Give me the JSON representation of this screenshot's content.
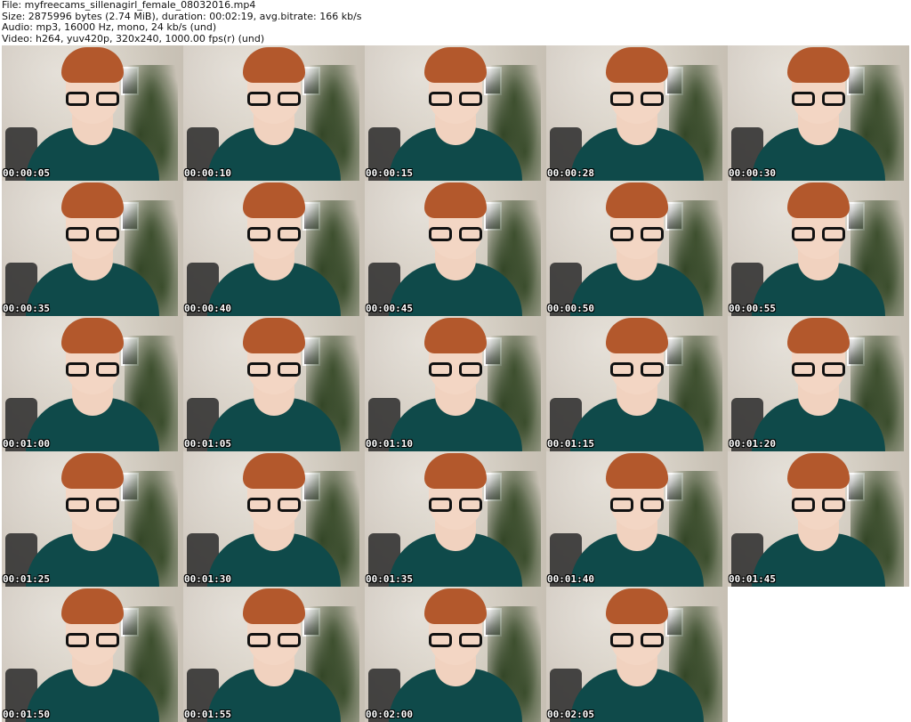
{
  "header": {
    "file": "File: myfreecams_sillenagirl_female_08032016.mp4",
    "size": "Size: 2875996 bytes (2.74 MiB), duration: 00:02:19, avg.bitrate: 166 kb/s",
    "audio": "Audio: mp3, 16000 Hz, mono, 24 kb/s (und)",
    "video": "Video: h264, yuv420p, 320x240, 1000.00 fps(r) (und)"
  },
  "thumbnails": [
    {
      "timestamp": "00:00:05"
    },
    {
      "timestamp": "00:00:10"
    },
    {
      "timestamp": "00:00:15"
    },
    {
      "timestamp": "00:00:28"
    },
    {
      "timestamp": "00:00:30"
    },
    {
      "timestamp": "00:00:35"
    },
    {
      "timestamp": "00:00:40"
    },
    {
      "timestamp": "00:00:45"
    },
    {
      "timestamp": "00:00:50"
    },
    {
      "timestamp": "00:00:55"
    },
    {
      "timestamp": "00:01:00"
    },
    {
      "timestamp": "00:01:05"
    },
    {
      "timestamp": "00:01:10"
    },
    {
      "timestamp": "00:01:15"
    },
    {
      "timestamp": "00:01:20"
    },
    {
      "timestamp": "00:01:25"
    },
    {
      "timestamp": "00:01:30"
    },
    {
      "timestamp": "00:01:35"
    },
    {
      "timestamp": "00:01:40"
    },
    {
      "timestamp": "00:01:45"
    },
    {
      "timestamp": "00:01:50"
    },
    {
      "timestamp": "00:01:55"
    },
    {
      "timestamp": "00:02:00"
    },
    {
      "timestamp": "00:02:05"
    }
  ]
}
